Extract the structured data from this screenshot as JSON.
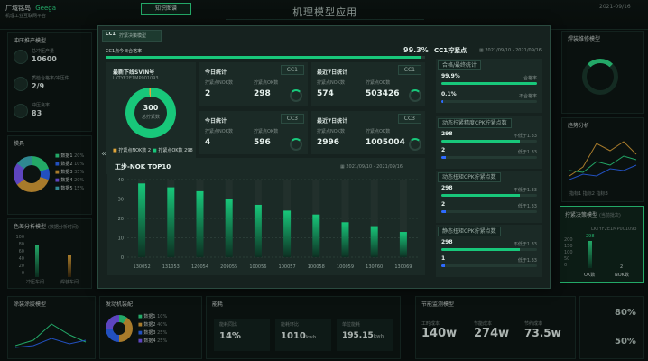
{
  "header": {
    "brand": "广域铭岛",
    "brand_sub": "Geega",
    "brand_caption": "机理工业互联网平台",
    "tab_button": "知识图谱",
    "title": "机理模型应用",
    "date": "2021-09/16"
  },
  "left": {
    "panel1": {
      "title": "冲压推产模型",
      "rows": [
        {
          "label": "总冲压产量",
          "value": "10600"
        },
        {
          "label": "质检合格率/冲压件",
          "value": "2/9"
        },
        {
          "label": "冲压良率",
          "value": "83"
        }
      ]
    },
    "panel2": {
      "title": "模具",
      "legend": [
        "数据1",
        "数据2",
        "数据3",
        "数据4",
        "数据5"
      ],
      "values": [
        "20%",
        "10%",
        "35%",
        "20%",
        "15%"
      ]
    },
    "panel3": {
      "title": "色差分析模型",
      "subtitle": "(数据分析时间)",
      "y": [
        "100",
        "80",
        "60",
        "40",
        "20",
        "0"
      ],
      "x": [
        "冲压车间",
        "焊装车间"
      ]
    }
  },
  "modal": {
    "tab": "拧紧决策模型",
    "cc_badge": "CC1",
    "cc1_rate_label": "CC1点今日合格率",
    "cc1_rate_value": "99.3%",
    "vin_title": "最新下线SVIN号",
    "vin_no": "LKTYF2E1MP001093",
    "donut_value": "300",
    "donut_caption": "总拧紧数",
    "legend_nok": "拧紧点NOK数 2",
    "legend_ok": "拧紧点OK数 298",
    "cards": [
      {
        "title": "今日统计",
        "tag": "CC1",
        "l1": "拧紧点NOK数",
        "l2": "拧紧点OK数",
        "v1": "2",
        "v2": "298"
      },
      {
        "title": "最近7日统计",
        "tag": "CC1",
        "l1": "拧紧点NOK数",
        "l2": "拧紧点OK数",
        "v1": "574",
        "v2": "503426"
      },
      {
        "title": "今日统计",
        "tag": "CC3",
        "l1": "拧紧点NOK数",
        "l2": "拧紧点OK数",
        "v1": "4",
        "v2": "596"
      },
      {
        "title": "最近7日统计",
        "tag": "CC3",
        "l1": "拧紧点NOK数",
        "l2": "拧紧点OK数",
        "v1": "2996",
        "v2": "1005004"
      }
    ],
    "chart_title": "工步-NOK TOP10",
    "chart_date": "2021/09/10 - 2021/09/16",
    "right_title": "CC1拧紧点",
    "right_date": "2021/09/10 - 2021/09/16",
    "rate_box": {
      "title": "合格/最终统计",
      "r1_value": "99.9%",
      "r1_label": "合格率",
      "r1_fill": 0.999,
      "r2_value": "0.1%",
      "r2_label": "不合格率",
      "r2_fill": 0.02
    },
    "groups": [
      {
        "title": "动态拧紧精度CPK拧紧点数",
        "a_value": "298",
        "a_label": "不低于1.33",
        "a_fill": 0.82,
        "b_value": "2",
        "b_label": "低于1.33",
        "b_fill": 0.05
      },
      {
        "title": "动态扭矩CPK拧紧点数",
        "a_value": "298",
        "a_label": "不低于1.33",
        "a_fill": 0.82,
        "b_value": "2",
        "b_label": "低于1.33",
        "b_fill": 0.05
      },
      {
        "title": "静态扭矩CPK拧紧点数",
        "a_value": "298",
        "a_label": "不低于1.33",
        "a_fill": 0.82,
        "b_value": "1",
        "b_label": "低于1.33",
        "b_fill": 0.04
      }
    ]
  },
  "chart_data": {
    "type": "bar",
    "title": "工步-NOK TOP10",
    "categories": [
      "130052",
      "131053",
      "120054",
      "209055",
      "100056",
      "100057",
      "100058",
      "100059",
      "130760",
      "130069"
    ],
    "values": [
      38,
      36,
      34,
      30,
      27,
      24,
      22,
      18,
      16,
      13
    ],
    "ylim": [
      0,
      40
    ],
    "yticks": [
      0,
      10,
      20,
      30,
      40
    ]
  },
  "right": {
    "p1_title": "焊装维修模型",
    "p2_title": "趋势分析",
    "p2_legend": [
      "指标1",
      "指标2",
      "指标3"
    ],
    "p3_title": "拧紧决策模型",
    "p3_tag": "(当前批次)",
    "p3_vin": "LKTYF2E1MP001093",
    "p3_ok": "298",
    "p3_nok": "2",
    "p3_ok_label": "OK数",
    "p3_nok_label": "NOK数",
    "p3_y": [
      "200",
      "150",
      "100",
      "50",
      "0"
    ]
  },
  "bottom": {
    "b1_title": "涂装涂胶模型",
    "b2_title": "发动机装配",
    "b2_legend": [
      "数据1",
      "数据2",
      "数据3",
      "数据4"
    ],
    "b2_vals": [
      "10%",
      "40%",
      "25%",
      "25%"
    ],
    "b3_title": "能耗",
    "b3_cells": [
      {
        "label": "能耗同比",
        "value": "14%"
      },
      {
        "label": "能耗环比",
        "value": "1010",
        "unit": "kwh"
      },
      {
        "label": "单位能耗",
        "value": "195.15",
        "unit": "kwh"
      }
    ],
    "b4_title": "节能监测模型",
    "b4_cells": [
      {
        "label": "工时成本",
        "value": "140w"
      },
      {
        "label": "节能成本",
        "value": "274w"
      },
      {
        "label": "节约成本",
        "value": "73.5w"
      }
    ],
    "b5_r1": "80%",
    "b5_r2": "50%"
  }
}
